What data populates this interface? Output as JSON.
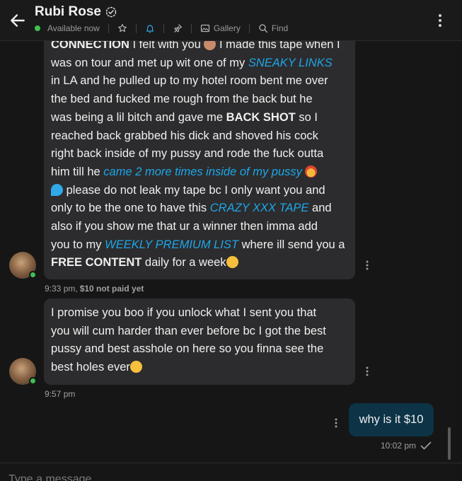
{
  "header": {
    "title": "Rubi Rose",
    "status": "Available now",
    "gallery_label": "Gallery",
    "find_label": "Find"
  },
  "messages": {
    "m1": {
      "l1a": "CONNECTION",
      "l1b": " I felt with you",
      "l1c": " I made this tape when I",
      "l2": "was on tour and met up wit one of my ",
      "l2h": "SNEAKY LINKS",
      "l3": "in LA and he pulled up to my hotel room bent me over",
      "l4": "the bed and fucked me rough from the back but he",
      "l5a": "was being a lil bitch and gave me ",
      "l5b": "BACK SHOT",
      "l5c": " so I",
      "l6": "reached back grabbed his dick and shoved his cock",
      "l7": "right back inside of my pussy and rode the fuck outta",
      "l8a": "him till he ",
      "l8h": "came 2 more times inside of my pussy",
      "l9": " please do not leak my tape bc I only want you and",
      "l10a": "only to be the one to have this ",
      "l10h": "CRAZY XXX TAPE",
      "l10b": " and",
      "l11": "also if you show me that ur a winner then imma add",
      "l12a": "you to my ",
      "l12h": "WEEKLY PREMIUM LIST",
      "l12b": " where ill send you a",
      "l13a": "FREE CONTENT",
      "l13b": " daily for a week",
      "time": "9:33 pm,",
      "paid": "$10 not paid yet"
    },
    "m2": {
      "l1": "I promise you boo if you unlock what I sent you that",
      "l2": "you will cum harder than ever before bc I got the best",
      "l3": "pussy and best asshole on here so you finna see the",
      "l4": "best holes ever",
      "time": "9:57 pm"
    },
    "m3": {
      "text": "why is it $10",
      "time": "10:02 pm"
    }
  },
  "composer": {
    "placeholder": "Type a message..."
  },
  "colors": {
    "highlight": "#1ea6e8",
    "online": "#3fbf54",
    "outgoing_bubble": "#0c3346"
  }
}
